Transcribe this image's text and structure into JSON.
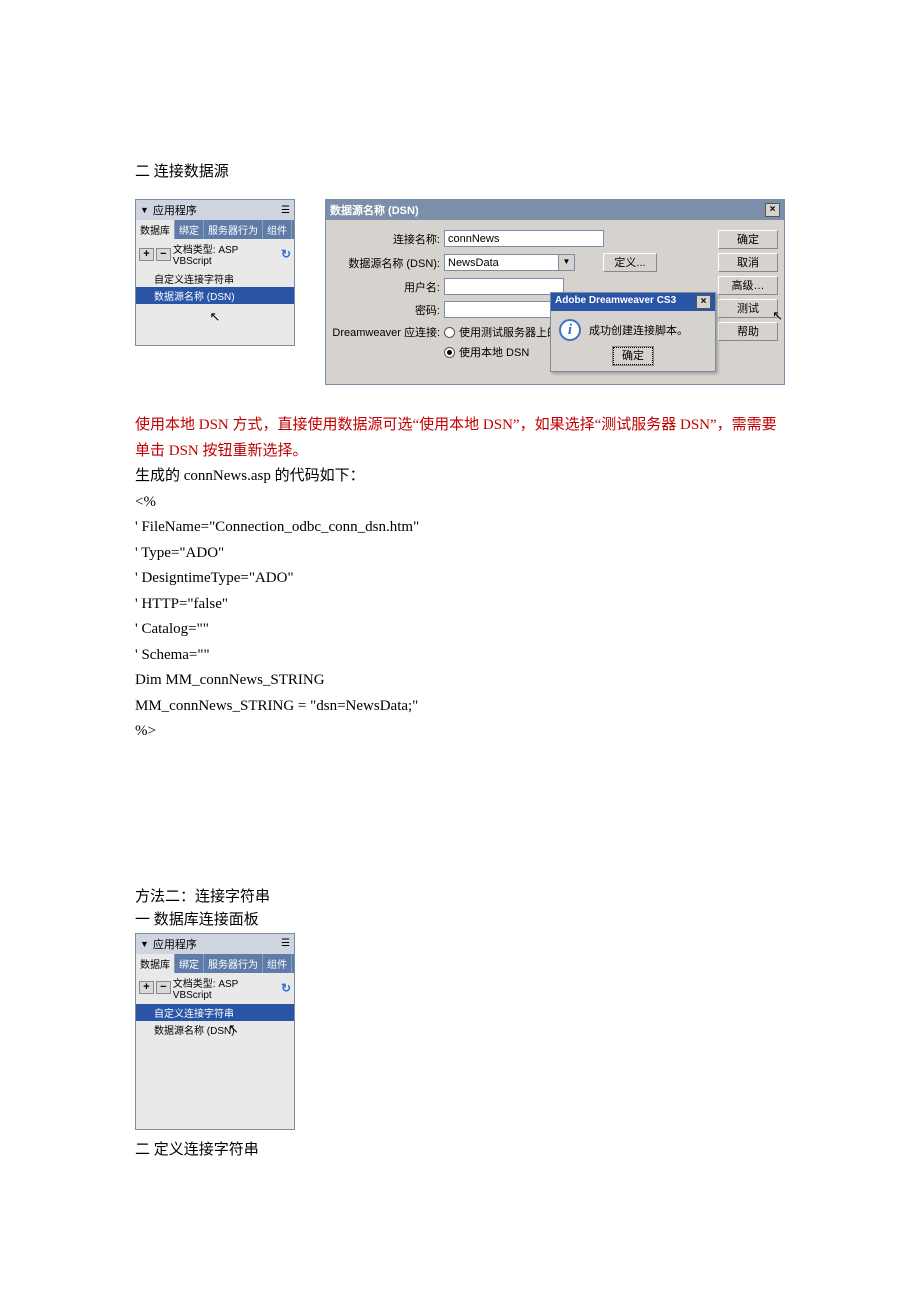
{
  "headings": {
    "sec2_title": "二  连接数据源",
    "method2": "方法二：连接字符串",
    "method2_sub1": "一    数据库连接面板",
    "method2_sub2": "二  定义连接字符串"
  },
  "app_panel": {
    "title": "应用程序",
    "tabs": [
      "数据库",
      "绑定",
      "服务器行为",
      "组件"
    ],
    "toolbar_doc_type": "文档类型: ASP VBScript",
    "plus": "+",
    "minus": "−",
    "menu": {
      "custom_conn": "自定义连接字符串",
      "dsn": "数据源名称 (DSN)"
    }
  },
  "dsn_dialog": {
    "title": "数据源名称 (DSN)",
    "labels": {
      "conn_name": "连接名称:",
      "dsn": "数据源名称 (DSN):",
      "user": "用户名:",
      "pass": "密码:",
      "dw_conn": "Dreamweaver 应连接:"
    },
    "values": {
      "conn_name": "connNews",
      "dsn": "NewsData"
    },
    "define": "定义...",
    "radios": {
      "test_server": "使用测试服务器上的 DSN",
      "local": "使用本地 DSN"
    },
    "buttons": {
      "ok": "确定",
      "cancel": "取消",
      "advanced": "高级…",
      "test": "测试",
      "help": "帮助"
    }
  },
  "success_popup": {
    "title": "Adobe Dreamweaver CS3",
    "msg": "成功创建连接脚本。",
    "ok": "确定"
  },
  "body": {
    "note1": "使用本地 DSN 方式，直接使用数据源可选“使用本地 DSN”，如果选择“测试服务器 DSN”，需需要单击 DSN 按钮重新选择。",
    "gen_line": "生成的 connNews.asp 的代码如下：",
    "code": [
      "<%",
      "' FileName=\"Connection_odbc_conn_dsn.htm\"",
      "' Type=\"ADO\"",
      "' DesigntimeType=\"ADO\"",
      "' HTTP=\"false\"",
      "' Catalog=\"\"",
      "' Schema=\"\"",
      "Dim MM_connNews_STRING",
      "MM_connNews_STRING = \"dsn=NewsData;\"",
      "%>"
    ]
  }
}
